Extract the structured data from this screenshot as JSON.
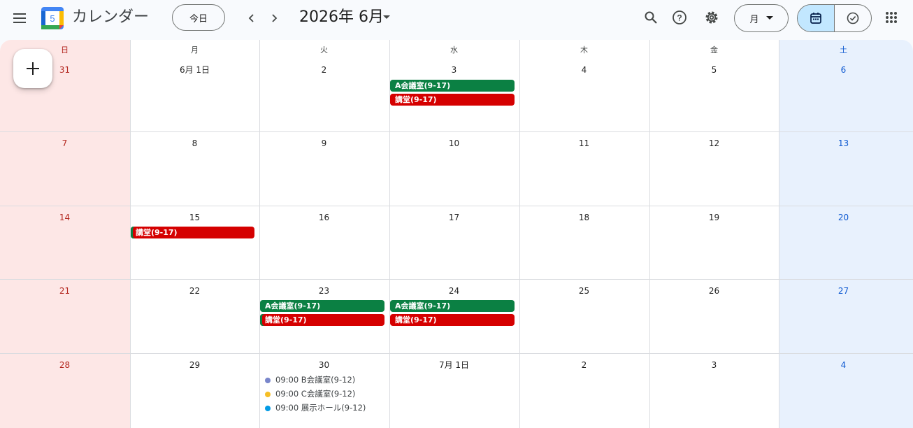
{
  "header": {
    "app_title": "カレンダー",
    "logo_day": "5",
    "today_label": "今日",
    "month_title": "2026年 6月",
    "view_label": "月"
  },
  "weekdays": [
    "日",
    "月",
    "火",
    "水",
    "木",
    "金",
    "土"
  ],
  "weeks": [
    [
      "31",
      "6月 1日",
      "2",
      "3",
      "4",
      "5",
      "6"
    ],
    [
      "7",
      "8",
      "9",
      "10",
      "11",
      "12",
      "13"
    ],
    [
      "14",
      "15",
      "16",
      "17",
      "18",
      "19",
      "20"
    ],
    [
      "21",
      "22",
      "23",
      "24",
      "25",
      "26",
      "27"
    ],
    [
      "28",
      "29",
      "30",
      "7月 1日",
      "2",
      "3",
      "4"
    ]
  ],
  "events": [
    {
      "week": 0,
      "day": 3,
      "slot": 0,
      "title": "A会議室(9-17)",
      "color": "#0b8043"
    },
    {
      "week": 0,
      "day": 3,
      "slot": 1,
      "title": "講堂(9-17)",
      "color": "#d50000"
    },
    {
      "week": 2,
      "day": 1,
      "slot": 0,
      "title": "講堂(9-17)",
      "color": "#d50000"
    },
    {
      "week": 3,
      "day": 2,
      "slot": 0,
      "title": "A会議室(9-17)",
      "color": "#0b8043"
    },
    {
      "week": 3,
      "day": 2,
      "slot": 1,
      "title": "講堂(9-17)",
      "color": "#d50000"
    },
    {
      "week": 3,
      "day": 3,
      "slot": 0,
      "title": "A会議室(9-17)",
      "color": "#0b8043"
    },
    {
      "week": 3,
      "day": 3,
      "slot": 1,
      "title": "講堂(9-17)",
      "color": "#d50000"
    }
  ],
  "timed_events": [
    {
      "week": 4,
      "day": 2,
      "slot": 0,
      "text": "09:00 B会議室(9-12)",
      "dot_color": "#7986cb"
    },
    {
      "week": 4,
      "day": 2,
      "slot": 1,
      "text": "09:00 C会議室(9-12)",
      "dot_color": "#f6bf26"
    },
    {
      "week": 4,
      "day": 2,
      "slot": 2,
      "text": "09:00 展示ホール(9-12)",
      "dot_color": "#039be5"
    }
  ],
  "colors": {
    "sunday_bg": "#fde7e6",
    "saturday_bg": "#e8f1fd",
    "sunday_text": "#b3261e",
    "saturday_text": "#0b57d0",
    "active_view_bg": "#c2e7ff"
  }
}
